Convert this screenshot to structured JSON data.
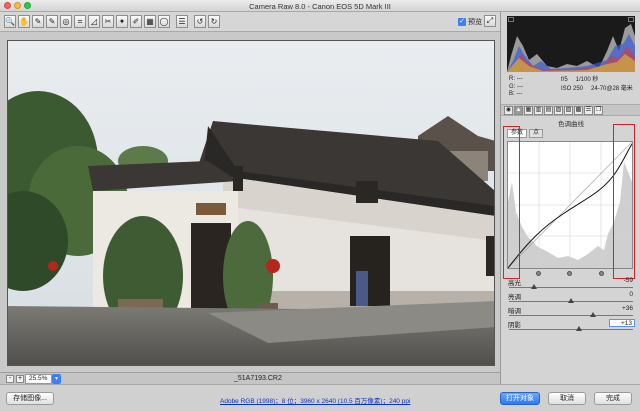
{
  "window": {
    "title": "Camera Raw 8.0 -  Canon EOS 5D Mark III"
  },
  "toolbar": {
    "tools": [
      {
        "name": "zoom-tool-icon",
        "glyph": "🔍"
      },
      {
        "name": "hand-tool-icon",
        "glyph": "✋"
      },
      {
        "name": "white-balance-tool-icon",
        "glyph": "✎"
      },
      {
        "name": "color-sampler-tool-icon",
        "glyph": "✎"
      },
      {
        "name": "targeted-adjustment-tool-icon",
        "glyph": "◎"
      },
      {
        "name": "crop-tool-icon",
        "glyph": "⌗"
      },
      {
        "name": "straighten-tool-icon",
        "glyph": "◿"
      },
      {
        "name": "spot-removal-tool-icon",
        "glyph": "✂"
      },
      {
        "name": "red-eye-tool-icon",
        "glyph": "✦"
      },
      {
        "name": "adjustment-brush-icon",
        "glyph": "✐"
      },
      {
        "name": "graduated-filter-icon",
        "glyph": "▦"
      },
      {
        "name": "radial-filter-icon",
        "glyph": "◯"
      },
      {
        "name": "preferences-icon",
        "glyph": "☰"
      },
      {
        "name": "rotate-left-icon",
        "glyph": "↺"
      },
      {
        "name": "rotate-right-icon",
        "glyph": "↻"
      }
    ],
    "preview_label": "预览",
    "preview_checked": true
  },
  "bottombar": {
    "zoom_out": "-",
    "zoom_in": "+",
    "zoom_value": "25.5%",
    "filename": "_51A7193.CR2"
  },
  "footer": {
    "save_label": "存储图像...",
    "workflow_link": "Adobe RGB (1998)；8 位；3960 x 2640 (10.5 百万像素)；240 ppi",
    "open_label": "打开对象",
    "cancel_label": "取消",
    "done_label": "完成"
  },
  "readout": {
    "r": "R:  ---",
    "g": "G:  ---",
    "b": "B:  ---",
    "aperture": "f/5",
    "shutter": "1/100 秒",
    "iso": "ISO 250",
    "lens": "24-70@28 毫米"
  },
  "panel": {
    "tabs": [
      "basic",
      "tone-curve",
      "detail",
      "hsl",
      "split-toning",
      "lens",
      "effects",
      "camera-calibration",
      "presets",
      "snapshots"
    ],
    "title": "色调曲线",
    "subtabs": [
      "参数",
      "点"
    ],
    "sliders": [
      {
        "label": "高光",
        "value": "-59",
        "fraction": 0.205
      },
      {
        "label": "亮调",
        "value": "0",
        "fraction": 0.5
      },
      {
        "label": "暗调",
        "value": "+36",
        "fraction": 0.68
      },
      {
        "label": "阴影",
        "value": "+13",
        "fraction": 0.565,
        "focused": true
      }
    ],
    "handles": [
      0.25,
      0.5,
      0.75
    ]
  },
  "colors": {
    "accent": "#3c80f6",
    "annotation": "#d8202a"
  }
}
